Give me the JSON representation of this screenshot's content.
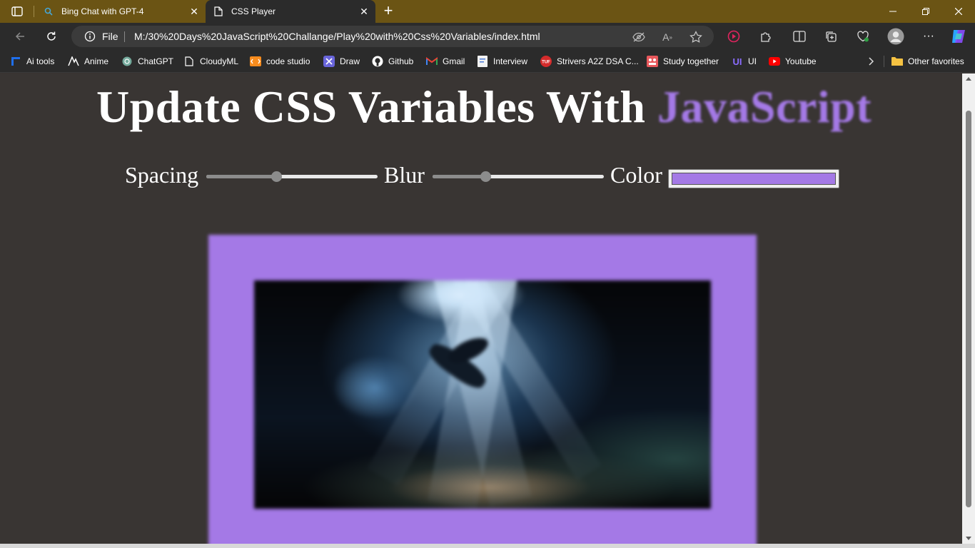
{
  "browser": {
    "tabs": [
      {
        "title": "Bing Chat with GPT-4",
        "icon": "search-icon",
        "active": false
      },
      {
        "title": "CSS Player",
        "icon": "page-icon",
        "active": true
      }
    ],
    "address": {
      "scheme_label": "File",
      "url": "M:/30%20Days%20JavaScript%20Challange/Play%20with%20Css%20Variables/index.html"
    },
    "bookmarks": [
      {
        "label": "Ai tools",
        "icon": "grid-icon"
      },
      {
        "label": "Anime",
        "icon": "anime-icon"
      },
      {
        "label": "ChatGPT",
        "icon": "chatgpt-icon"
      },
      {
        "label": "CloudyML",
        "icon": "page-icon"
      },
      {
        "label": "code studio",
        "icon": "code-studio-icon"
      },
      {
        "label": "Draw",
        "icon": "draw-icon"
      },
      {
        "label": "Github",
        "icon": "github-icon"
      },
      {
        "label": "Gmail",
        "icon": "gmail-icon"
      },
      {
        "label": "Interview",
        "icon": "interview-icon"
      },
      {
        "label": "Strivers A2Z DSA C...",
        "icon": "tuf-icon"
      },
      {
        "label": "Study together",
        "icon": "study-icon"
      },
      {
        "label": "UI",
        "icon": "ui-icon"
      },
      {
        "label": "Youtube",
        "icon": "youtube-icon"
      }
    ],
    "other_favorites": "Other favorites"
  },
  "page": {
    "heading_main": "Update CSS Variables With ",
    "heading_highlight": "JavaScript",
    "controls": {
      "spacing_label": "Spacing",
      "spacing_value": 0.41,
      "blur_label": "Blur",
      "blur_value": 0.31,
      "color_label": "Color",
      "color_value": "#a479e6"
    }
  },
  "colors": {
    "accent": "#a479e6",
    "titlebar": "#6b5414",
    "page_background": "#393533"
  }
}
